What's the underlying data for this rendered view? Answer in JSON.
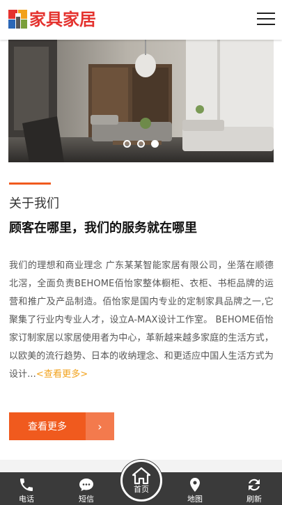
{
  "header": {
    "logo_text": "家具家居",
    "menu_icon": "hamburger-menu-icon"
  },
  "banner": {
    "slide_count": 3,
    "active_slide": 2
  },
  "about": {
    "section_title": "关于我们",
    "heading": "顾客在哪里，我们的服务就在哪里",
    "description": "我们的理想和商业理念 广东某某智能家居有限公司，坐落在顺德北滘，全面负责BEHOME佰怡家整体橱柜、衣柜、书柜品牌的运营和推广及产品制造。佰怡家是国内专业的定制家具品牌之一,它聚集了行业内专业人才，设立A-MAX设计工作室。 BEHOME佰怡家订制家居以家居使用者为中心，革新越来越多家庭的生活方式，以欧美的流行趋势、日本的收纳理念、和更适应中国人生活方式为设计...",
    "more_link": "<查看更多>",
    "button_label": "查看更多",
    "button_arrow": "›"
  },
  "bottom_nav": {
    "items": [
      {
        "label": "电话",
        "icon": "phone-icon"
      },
      {
        "label": "短信",
        "icon": "message-icon"
      },
      {
        "label": "首页",
        "icon": "home-icon"
      },
      {
        "label": "地图",
        "icon": "map-pin-icon"
      },
      {
        "label": "刷新",
        "icon": "refresh-icon"
      }
    ]
  },
  "colors": {
    "brand_red": "#e4322e",
    "accent_orange": "#f05a1e",
    "link_yellow": "#f2a21b",
    "nav_bg": "#3a3a3a"
  }
}
